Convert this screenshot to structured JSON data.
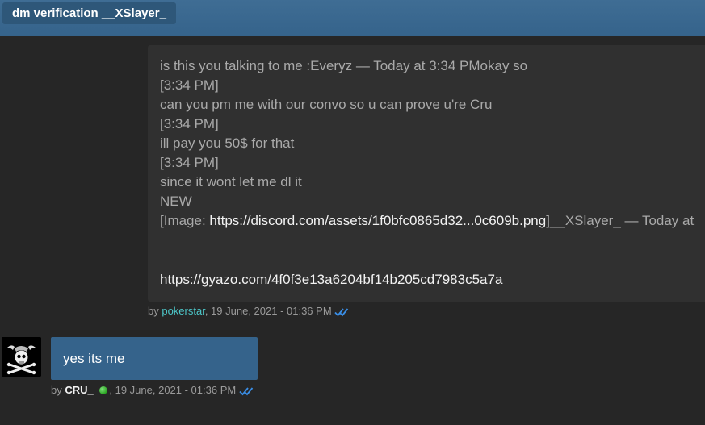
{
  "header": {
    "title": "dm verification __XSlayer_"
  },
  "incoming": {
    "lines": [
      "is this you talking to me :Everyz  — Today at 3:34 PMokay so",
      "[3:34 PM]",
      "can you pm me with our convo so u can prove u're Cru",
      "[3:34 PM]",
      "ill pay you 50$ for that",
      "[3:34 PM]",
      "since it wont let me dl it",
      "NEW"
    ],
    "image_prefix": "[Image: ",
    "image_link": "https://discord.com/assets/1f0bfc0865d32...0c609b.png",
    "image_suffix": "]__XSlayer_  — Today at",
    "gyazo_link": "https://gyazo.com/4f0f3e13a6204bf14b205cd7983c5a7a",
    "meta": {
      "by": "by ",
      "user": "pokerstar",
      "date": ", 19 June, 2021 - 01:36 PM"
    }
  },
  "outgoing": {
    "text": "yes its me",
    "meta": {
      "by": "by ",
      "user": "CRU_",
      "date": ", 19 June, 2021 - 01:36 PM"
    }
  },
  "colors": {
    "accent": "#35638b",
    "link_user": "#4dc7c9",
    "read_check": "#3a8ee6",
    "online": "#27a31f"
  },
  "icons": {
    "read_receipt": "double-check-icon",
    "online": "online-status-icon",
    "avatar": "skull-flag-avatar"
  }
}
